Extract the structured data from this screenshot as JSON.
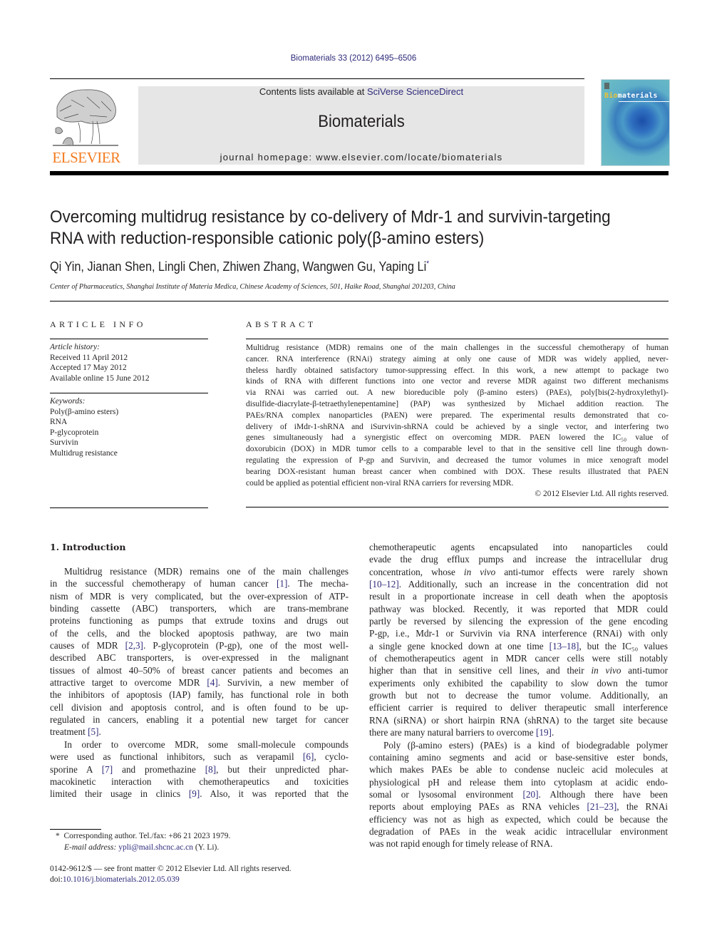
{
  "header": {
    "citation": "Biomaterials 33 (2012) 6495–6506",
    "contents_prefix": "Contents lists available at ",
    "contents_link": "SciVerse ScienceDirect",
    "journal_name": "Biomaterials",
    "homepage": "journal homepage: www.elsevier.com/locate/biomaterials",
    "publisher_logo_text": "ELSEVIER",
    "cover_title_accent": "Bio",
    "cover_title_rest": "materials",
    "colors": {
      "publisher_orange": "#f47b20",
      "link_blue": "#2e2a7a",
      "banner_gray": "#e6e6e6"
    }
  },
  "article": {
    "title_lines": [
      "Overcoming multidrug resistance by co-delivery of Mdr-1 and survivin-targeting",
      "RNA with reduction-responsible cationic poly(β-amino esters)"
    ],
    "authors": "Qi Yin, Jianan Shen, Lingli Chen, Zhiwen Zhang, Wangwen Gu, Yaping Li",
    "corresponding_mark": "*",
    "affiliation": "Center of Pharmaceutics, Shanghai Institute of Materia Medica, Chinese Academy of Sciences, 501, Haike Road, Shanghai 201203, China"
  },
  "article_info": {
    "heading": "ARTICLE INFO",
    "history_label": "Article history:",
    "history": [
      "Received 11 April 2012",
      "Accepted 17 May 2012",
      "Available online 15 June 2012"
    ],
    "keywords_label": "Keywords:",
    "keywords": [
      "Poly(β-amino esters)",
      "RNA",
      "P-glycoprotein",
      "Survivin",
      "Multidrug resistance"
    ]
  },
  "abstract": {
    "heading": "ABSTRACT",
    "lines": [
      "Multidrug resistance (MDR) remains one of the main challenges in the successful chemotherapy of human",
      "cancer. RNA interference (RNAi) strategy aiming at only one cause of MDR was widely applied, never-",
      "theless hardly obtained satisfactory tumor-suppressing effect. In this work, a new attempt to package two",
      "kinds of RNA with different functions into one vector and reverse MDR against two different mechanisms",
      "via RNAi was carried out. A new bioreducible poly (β-amino esters) (PAEs), poly[bis(2-hydroxylethyl)-",
      "disulfide-diacrylate-β-tetraethylenepentamine] (PAP) was synthesized by Michael addition reaction. The",
      "PAEs/RNA complex nanoparticles (PAEN) were prepared. The experimental results demonstrated that co-",
      "delivery of iMdr-1-shRNA and iSurvivin-shRNA could be achieved by a single vector, and interfering two",
      "genes simultaneously had a synergistic effect on overcoming MDR. PAEN lowered the IC₅₀ value of",
      "doxorubicin (DOX) in MDR tumor cells to a comparable level to that in the sensitive cell line through down-",
      "regulating the expression of P-gp and Survivin, and decreased the tumor volumes in mice xenograft model",
      "bearing DOX-resistant human breast cancer when combined with DOX. These results illustrated that PAEN",
      "could be applied as potential efficient non-viral RNA carriers for reversing MDR."
    ],
    "copyright": "© 2012 Elsevier Ltd. All rights reserved."
  },
  "intro": {
    "heading": "1.  Introduction",
    "left_lines": [
      {
        "t": "Multidrug resistance (MDR) remains one of the main challenges",
        "indent": true
      },
      {
        "t": "in the successful chemotherapy of human cancer [1]. The mecha-"
      },
      {
        "t": "nism of MDR is very complicated, but the over-expression of ATP-"
      },
      {
        "t": "binding cassette (ABC) transporters, which are trans-membrane"
      },
      {
        "t": "proteins functioning as pumps that extrude toxins and drugs out"
      },
      {
        "t": "of the cells, and the blocked apoptosis pathway, are two main"
      },
      {
        "t": "causes of MDR [2,3]. P-glycoprotein (P-gp), one of the most well-"
      },
      {
        "t": "described ABC transporters, is over-expressed in the malignant"
      },
      {
        "t": "tissues of almost 40–50% of breast cancer patients and becomes an"
      },
      {
        "t": "attractive target to overcome MDR [4]. Survivin, a new member of"
      },
      {
        "t": "the inhibitors of apoptosis (IAP) family, has functional role in both"
      },
      {
        "t": "cell division and apoptosis control, and is often found to be up-"
      },
      {
        "t": "regulated in cancers, enabling it a potential new target for cancer"
      },
      {
        "t": "treatment [5].",
        "last": true
      },
      {
        "t": "In order to overcome MDR, some small-molecule compounds",
        "indent": true
      },
      {
        "t": "were used as functional inhibitors, such as verapamil [6], cyclo-"
      },
      {
        "t": "sporine A [7] and promethazine [8], but their unpredicted phar-"
      },
      {
        "t": "macokinetic interaction with chemotherapeutics and toxicities"
      },
      {
        "t": "limited their usage in clinics [9]. Also, it was reported that the"
      }
    ],
    "right_lines": [
      {
        "t": "chemotherapeutic agents encapsulated into nanoparticles could"
      },
      {
        "t": "evade the drug efflux pumps and increase the intracellular drug"
      },
      {
        "t": "concentration, whose in vivo anti-tumor effects were rarely shown"
      },
      {
        "t": "[10–12]. Additionally, such an increase in the concentration did not"
      },
      {
        "t": "result in a proportionate increase in cell death when the apoptosis"
      },
      {
        "t": "pathway was blocked. Recently, it was reported that MDR could"
      },
      {
        "t": "partly be reversed by silencing the expression of the gene encoding"
      },
      {
        "t": "P-gp, i.e., Mdr-1 or Survivin via RNA interference (RNAi) with only"
      },
      {
        "t": "a single gene knocked down at one time [13–18], but the IC₅₀ values"
      },
      {
        "t": "of chemotherapeutics agent in MDR cancer cells were still notably"
      },
      {
        "t": "higher than that in sensitive cell lines, and their in vivo anti-tumor"
      },
      {
        "t": "experiments only exhibited the capability to slow down the tumor"
      },
      {
        "t": "growth but not to decrease the tumor volume. Additionally, an"
      },
      {
        "t": "efficient carrier is required to deliver therapeutic small interference"
      },
      {
        "t": "RNA (siRNA) or short hairpin RNA (shRNA) to the target site because"
      },
      {
        "t": "there are many natural barriers to overcome [19].",
        "last": true
      },
      {
        "t": "Poly (β-amino esters) (PAEs) is a kind of biodegradable polymer",
        "indent": true
      },
      {
        "t": "containing amino segments and acid or base-sensitive ester bonds,"
      },
      {
        "t": "which makes PAEs be able to condense nucleic acid molecules at"
      },
      {
        "t": "physiological pH and release them into cytoplasm at acidic endo-"
      },
      {
        "t": "somal or lysosomal environment [20]. Although there have been"
      },
      {
        "t": "reports about employing PAEs as RNA vehicles [21–23], the RNAi"
      },
      {
        "t": "efficiency was not as high as expected, which could be because the"
      },
      {
        "t": "degradation of PAEs in the weak acidic intracellular environment"
      },
      {
        "t": "was not rapid enough for timely release of RNA.",
        "last": true
      }
    ]
  },
  "footnote": {
    "mark": "*",
    "corresponding": "Corresponding author. Tel./fax: +86 21 2023 1979.",
    "email_label": "E-mail address: ",
    "email": "ypli@mail.shcnc.ac.cn",
    "email_suffix": " (Y. Li)."
  },
  "front_matter": {
    "issn_line": "0142-9612/$ — see front matter © 2012 Elsevier Ltd. All rights reserved.",
    "doi_label": "doi:",
    "doi": "10.1016/j.biomaterials.2012.05.039"
  }
}
